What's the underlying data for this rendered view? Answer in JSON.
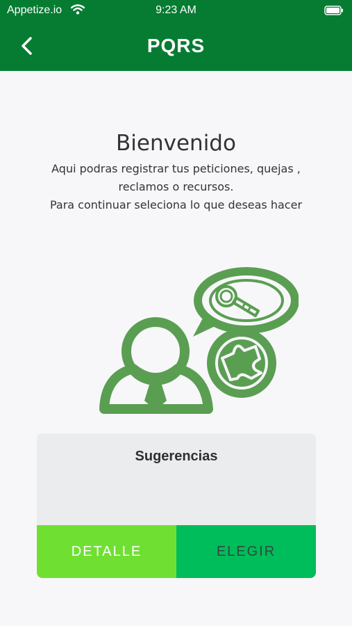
{
  "status_bar": {
    "carrier": "Appetize.io",
    "time": "9:23 AM",
    "icons": [
      "wifi-icon",
      "battery-icon"
    ]
  },
  "nav": {
    "title": "PQRS",
    "back_icon": "chevron-left-icon"
  },
  "welcome": {
    "title": "Bienvenido",
    "line1": "Aqui podras registrar tus peticiones, quejas ,",
    "line2": "reclamos o recursos.",
    "line3": "Para continuar seleciona lo que deseas hacer"
  },
  "illustration": {
    "icons": [
      "person-icon",
      "magnifier-icon",
      "puzzle-icon"
    ],
    "color": "#5a9e52"
  },
  "card": {
    "title": "Sugerencias",
    "detail_label": "DETALLE",
    "choose_label": "ELEGIR"
  },
  "colors": {
    "header": "#067c32",
    "background": "#f7f7f9",
    "detail_button": "#6fe032",
    "choose_button": "#00bd5b"
  }
}
